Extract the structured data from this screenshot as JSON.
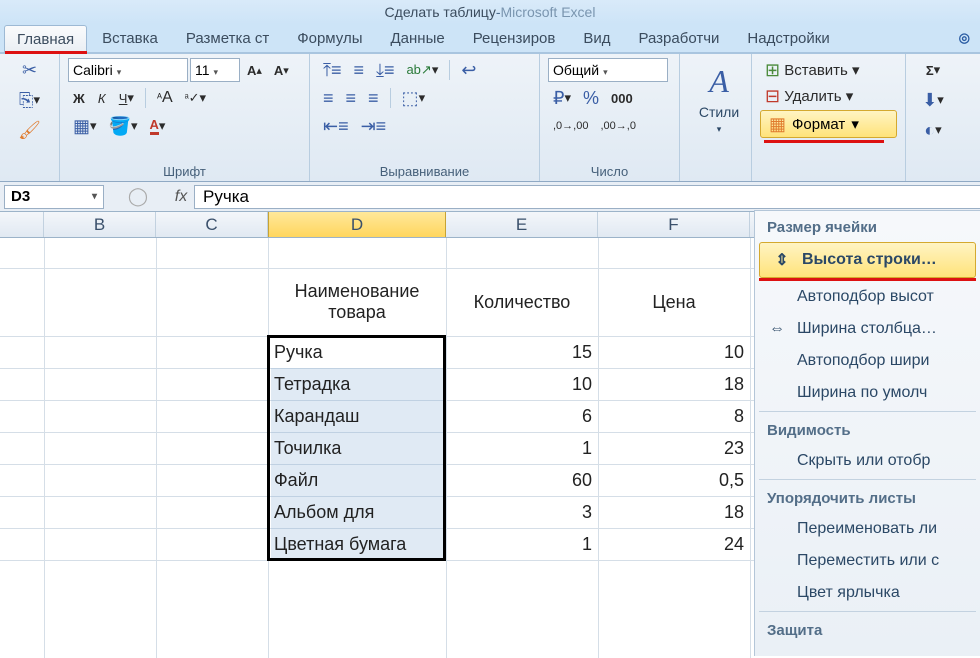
{
  "title": {
    "doc": "Сделать таблицу",
    "sep": " - ",
    "app": "Microsoft Excel"
  },
  "tabs": [
    "Главная",
    "Вставка",
    "Разметка ст",
    "Формулы",
    "Данные",
    "Рецензиров",
    "Вид",
    "Разработчи",
    "Надстройки"
  ],
  "active_tab_index": 0,
  "ribbon_groups": {
    "clipboard": " ",
    "font": "Шрифт",
    "alignment": "Выравнивание",
    "number": "Число",
    "styles": "Стили",
    "cells": " "
  },
  "font": {
    "name": "Calibri",
    "size": "11",
    "b": "Ж",
    "i": "К",
    "u": "Ч"
  },
  "number_format": "Общий",
  "styles_btn": "Стили",
  "cells_btns": {
    "insert": "Вставить",
    "delete": "Удалить",
    "format": "Формат"
  },
  "namebox": "D3",
  "fx": "fx",
  "formula_value": "Ручка",
  "col_headers": [
    "",
    "B",
    "C",
    "D",
    "E",
    "F"
  ],
  "header_row": {
    "d": "Наименование товара",
    "e": "Количество",
    "f": "Цена"
  },
  "rows": [
    {
      "d": "Ручка",
      "e": "15",
      "f": "10"
    },
    {
      "d": "Тетрадка",
      "e": "10",
      "f": "18"
    },
    {
      "d": "Карандаш",
      "e": "6",
      "f": "8"
    },
    {
      "d": "Точилка",
      "e": "1",
      "f": "23"
    },
    {
      "d": "Файл",
      "e": "60",
      "f": "0,5"
    },
    {
      "d": "Альбом для",
      "e": "3",
      "f": "18"
    },
    {
      "d": "Цветная бумага",
      "e": "1",
      "f": "24"
    }
  ],
  "format_menu": {
    "section_size": "Размер ячейки",
    "row_height": "Высота строки…",
    "autofit_row": "Автоподбор высот",
    "col_width": "Ширина столбца…",
    "autofit_col": "Автоподбор шири",
    "default_width": "Ширина по умолч",
    "section_vis": "Видимость",
    "hide": "Скрыть или отобр",
    "section_org": "Упорядочить листы",
    "rename": "Переименовать ли",
    "move": "Переместить или с",
    "tab_color": "Цвет ярлычка",
    "section_prot": "Защита"
  }
}
